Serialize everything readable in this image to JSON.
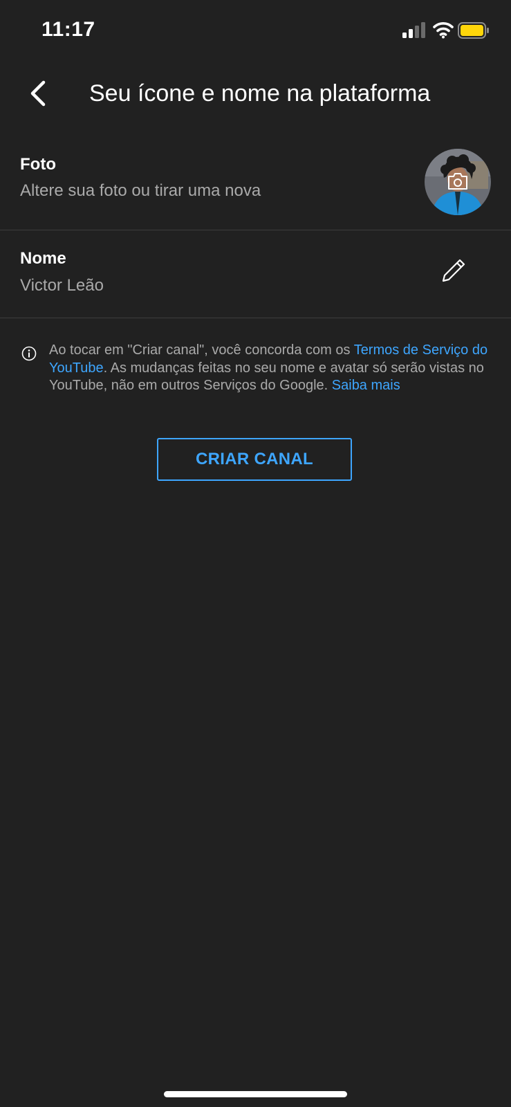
{
  "status_bar": {
    "time": "11:17",
    "icons": [
      "signal-icon",
      "wifi-icon",
      "battery-icon"
    ],
    "battery_color": "#ffd60a"
  },
  "header": {
    "back_icon": "chevron-left-icon",
    "title": "Seu ícone e nome na plataforma"
  },
  "photo_row": {
    "label": "Foto",
    "subtitle": "Altere sua foto ou tirar uma nova",
    "overlay_icon": "camera-icon"
  },
  "name_row": {
    "label": "Nome",
    "value": "Victor Leão",
    "edit_icon": "pencil-icon"
  },
  "info": {
    "icon": "info-icon",
    "text_before_link": "Ao tocar em \"Criar canal\", você concorda com os ",
    "terms_link": "Termos de Serviço do YouTube",
    "text_after_link": ". As mudanças feitas no seu nome e avatar só serão vistas no YouTube, não em outros Serviços do Google. ",
    "learn_more_link": "Saiba mais"
  },
  "create_button_label": "CRIAR CANAL",
  "colors": {
    "background": "#212121",
    "accent": "#3ea6ff",
    "secondary_text": "#aaaaaa",
    "divider": "#3d3d3d"
  }
}
